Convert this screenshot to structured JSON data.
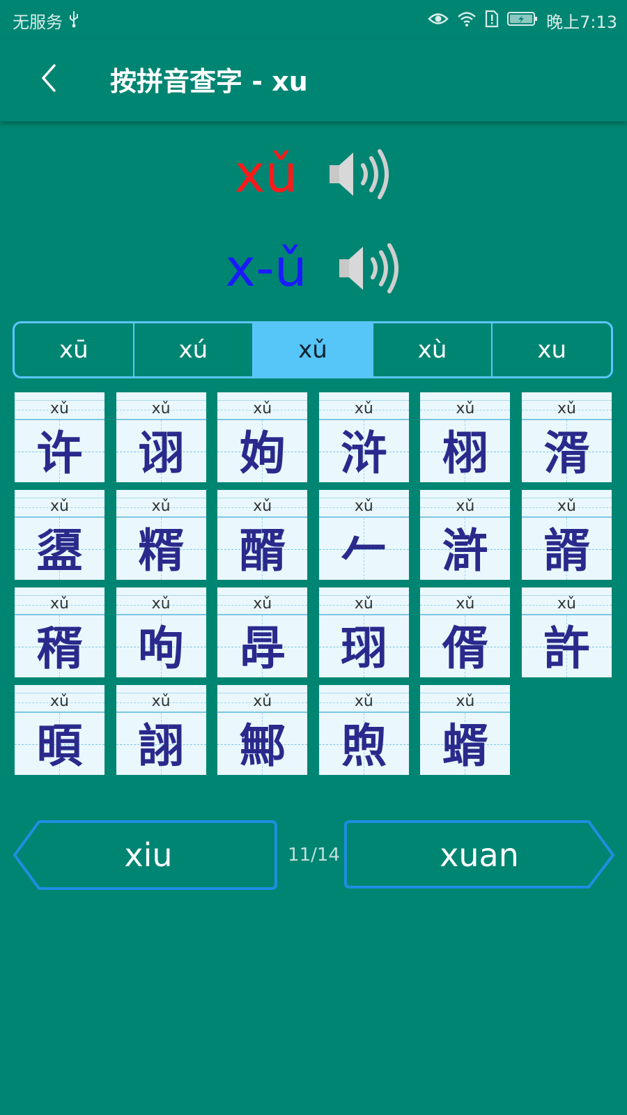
{
  "status_bar": {
    "carrier": "无服务",
    "time": "晚上7:13"
  },
  "header": {
    "title": "按拼音查字 - xu"
  },
  "pronunciation": {
    "syllable": "xǔ",
    "spelled": "x-ǔ",
    "syllable_color": "#ff1a1a",
    "spelled_color": "#1a1aff"
  },
  "tones": [
    {
      "label": "xū",
      "active": false
    },
    {
      "label": "xú",
      "active": false
    },
    {
      "label": "xǔ",
      "active": true
    },
    {
      "label": "xù",
      "active": false
    },
    {
      "label": "xu",
      "active": false
    }
  ],
  "characters": [
    {
      "pinyin": "xǔ",
      "char": "许"
    },
    {
      "pinyin": "xǔ",
      "char": "诩"
    },
    {
      "pinyin": "xǔ",
      "char": "姁"
    },
    {
      "pinyin": "xǔ",
      "char": "浒"
    },
    {
      "pinyin": "xǔ",
      "char": "栩"
    },
    {
      "pinyin": "xǔ",
      "char": "湑"
    },
    {
      "pinyin": "xǔ",
      "char": "盨"
    },
    {
      "pinyin": "xǔ",
      "char": "糈"
    },
    {
      "pinyin": "xǔ",
      "char": "醑"
    },
    {
      "pinyin": "xǔ",
      "char": "𠂉"
    },
    {
      "pinyin": "xǔ",
      "char": "滸"
    },
    {
      "pinyin": "xǔ",
      "char": "諝"
    },
    {
      "pinyin": "xǔ",
      "char": "稰"
    },
    {
      "pinyin": "xǔ",
      "char": "呴"
    },
    {
      "pinyin": "xǔ",
      "char": "冔"
    },
    {
      "pinyin": "xǔ",
      "char": "珝"
    },
    {
      "pinyin": "xǔ",
      "char": "偦"
    },
    {
      "pinyin": "xǔ",
      "char": "許"
    },
    {
      "pinyin": "xǔ",
      "char": "暊"
    },
    {
      "pinyin": "xǔ",
      "char": "詡"
    },
    {
      "pinyin": "xǔ",
      "char": "鄦"
    },
    {
      "pinyin": "xǔ",
      "char": "煦"
    },
    {
      "pinyin": "xǔ",
      "char": "蝑"
    }
  ],
  "navigation": {
    "prev_label": "xiu",
    "next_label": "xuan",
    "page": "11/14"
  },
  "colors": {
    "background": "#008573",
    "tab_active": "#56c5f7",
    "border": "#5bc6ff",
    "char_color": "#2a2a8c"
  }
}
